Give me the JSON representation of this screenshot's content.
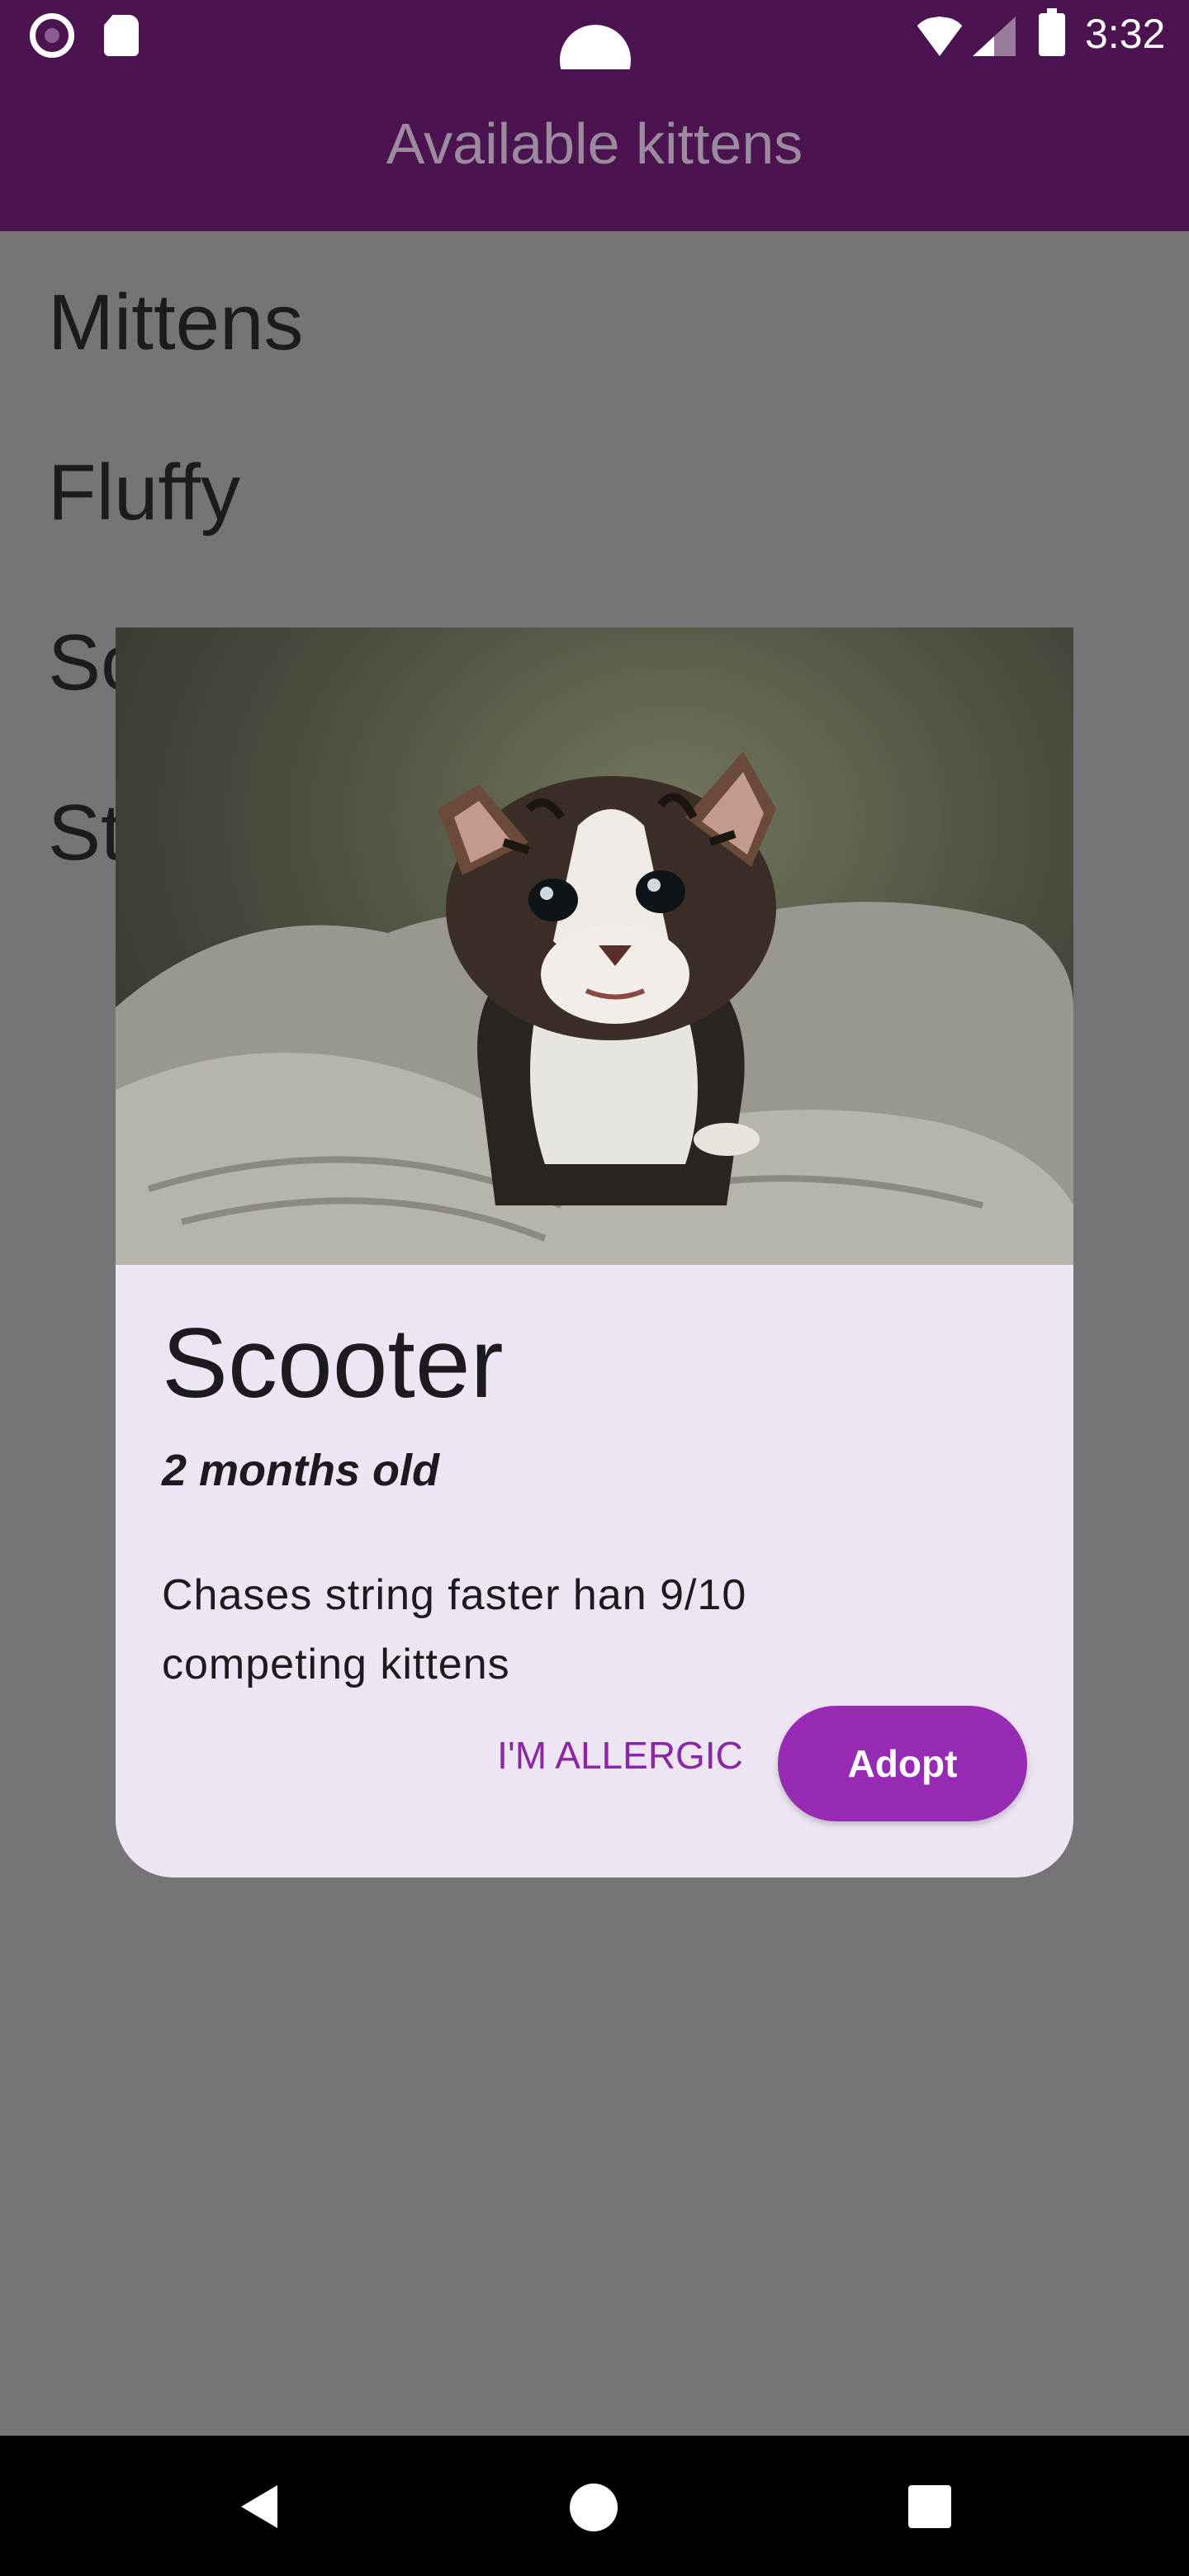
{
  "status_bar": {
    "time": "3:32",
    "icons": [
      "record-icon",
      "sd-card-icon",
      "camera-cutout-icon",
      "wifi-icon",
      "cell-signal-icon",
      "battery-icon"
    ]
  },
  "app_bar": {
    "title": "Available kittens"
  },
  "list": {
    "items": [
      {
        "label": "Mittens"
      },
      {
        "label": "Fluffy"
      },
      {
        "label": "Sc"
      },
      {
        "label": "St"
      }
    ]
  },
  "dialog": {
    "name": "Scooter",
    "age": "2 months old",
    "description": "Chases string faster han 9/10 competing kittens",
    "secondary_button": "I'M ALLERGIC",
    "primary_button": "Adopt",
    "image": "kitten-photo"
  },
  "nav_bar": {
    "icons": [
      "back-icon",
      "home-icon",
      "recents-icon"
    ]
  },
  "colors": {
    "app_bar": "#4b1450",
    "scrim": "#767477",
    "dialog_bg": "#ede5f2",
    "accent": "#972bb3"
  }
}
